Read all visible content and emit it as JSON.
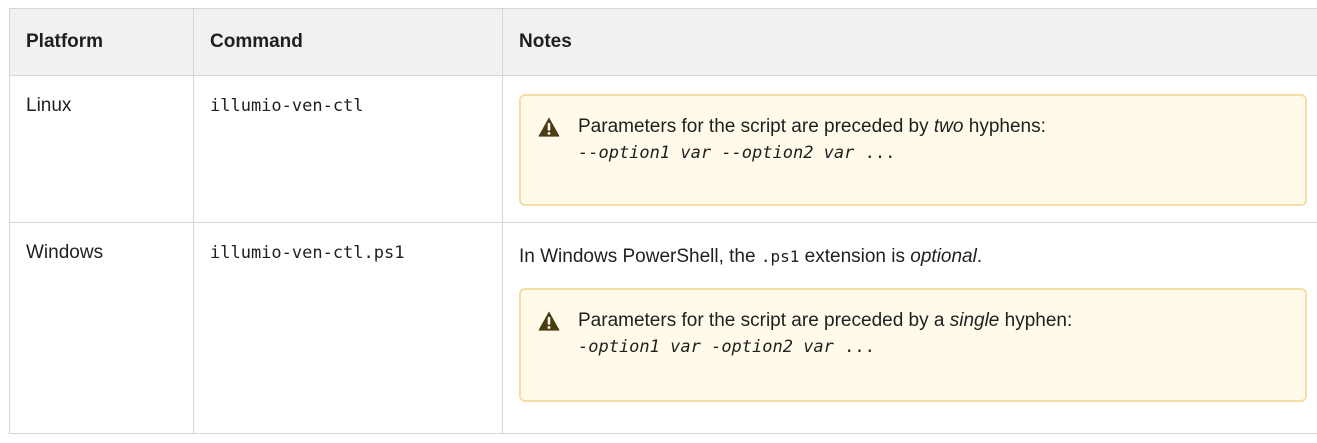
{
  "headers": {
    "platform": "Platform",
    "command": "Command",
    "notes": "Notes"
  },
  "rows": [
    {
      "platform": "Linux",
      "command": "illumio-ven-ctl",
      "warning": {
        "icon": "warning-icon",
        "text_before": "Parameters for the script are preceded by ",
        "emphasis": "two",
        "text_after": " hyphens:",
        "opt1": "--option1 var",
        "opt2": "--option2 var",
        "ellipsis": "..."
      }
    },
    {
      "platform": "Windows",
      "command": "illumio-ven-ctl.ps1",
      "note": {
        "text_before": "In Windows PowerShell, the ",
        "code": ".ps1",
        "text_mid": " extension is ",
        "emphasis": "optional",
        "text_after": "."
      },
      "warning": {
        "icon": "warning-icon",
        "text_before": "Parameters for the script are preceded by a ",
        "emphasis": "single",
        "text_after": " hyphen:",
        "opt1": "-option1 var",
        "opt2": "-option2 var",
        "ellipsis": "..."
      }
    }
  ],
  "colors": {
    "warning_bg": "#fffaea",
    "warning_border": "#f3dfa3",
    "warning_icon": "#4a3d13",
    "header_bg": "#f1f1f1"
  }
}
